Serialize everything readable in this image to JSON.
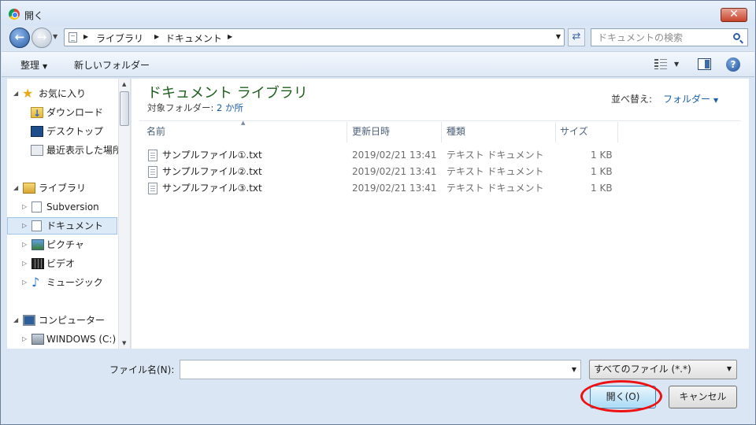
{
  "window": {
    "title": "開く"
  },
  "address": {
    "crumbs": [
      "ライブラリ",
      "ドキュメント"
    ],
    "search_placeholder": "ドキュメントの検索"
  },
  "toolbar": {
    "organize_label": "整理",
    "new_folder_label": "新しいフォルダー"
  },
  "nav": {
    "favorites": "お気に入り",
    "downloads": "ダウンロード",
    "desktop": "デスクトップ",
    "recent": "最近表示した場所",
    "libraries": "ライブラリ",
    "subversion": "Subversion",
    "documents": "ドキュメント",
    "pictures": "ピクチャ",
    "videos": "ビデオ",
    "music": "ミュージック",
    "computer": "コンピューター",
    "drive": "WINDOWS (C:)"
  },
  "content": {
    "title": "ドキュメント ライブラリ",
    "subtitle_prefix": "対象フォルダー: ",
    "subtitle_link": "2 か所",
    "arrange_label": "並べ替え:",
    "arrange_value": "フォルダー",
    "columns": {
      "name": "名前",
      "date": "更新日時",
      "type": "種類",
      "size": "サイズ"
    },
    "files": [
      {
        "name": "サンプルファイル①.txt",
        "date": "2019/02/21 13:41",
        "type": "テキスト ドキュメント",
        "size": "1 KB"
      },
      {
        "name": "サンプルファイル②.txt",
        "date": "2019/02/21 13:41",
        "type": "テキスト ドキュメント",
        "size": "1 KB"
      },
      {
        "name": "サンプルファイル③.txt",
        "date": "2019/02/21 13:41",
        "type": "テキスト ドキュメント",
        "size": "1 KB"
      }
    ]
  },
  "footer": {
    "filename_label": "ファイル名(N):",
    "filename_value": "",
    "filter_value": "すべてのファイル (*.*)",
    "open_label": "開く(O)",
    "cancel_label": "キャンセル"
  }
}
